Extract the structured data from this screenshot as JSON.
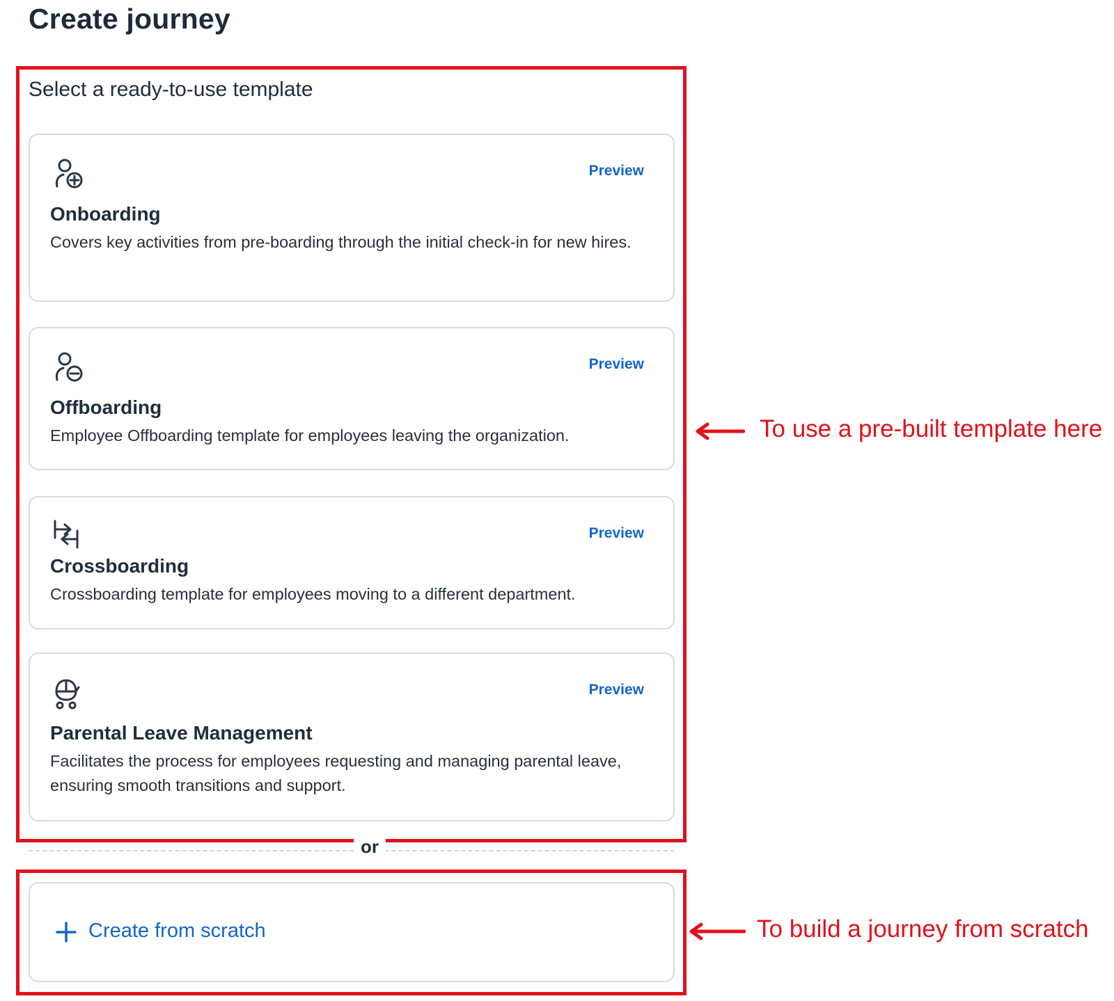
{
  "page": {
    "title": "Create journey"
  },
  "templates_section": {
    "heading": "Select a ready-to-use template",
    "cards": [
      {
        "icon": "person-add-icon",
        "title": "Onboarding",
        "description": "Covers key activities from pre-boarding through the initial check-in for new hires.",
        "preview_label": "Preview"
      },
      {
        "icon": "person-remove-icon",
        "title": "Offboarding",
        "description": "Employee Offboarding template for employees leaving the organization.",
        "preview_label": "Preview"
      },
      {
        "icon": "transfer-arrows-icon",
        "title": "Crossboarding",
        "description": "Crossboarding template for employees moving to a different department.",
        "preview_label": "Preview"
      },
      {
        "icon": "baby-stroller-icon",
        "title": "Parental Leave Management",
        "description": "Facilitates the process for employees requesting and managing parental leave, ensuring smooth transitions and support.",
        "preview_label": "Preview"
      }
    ]
  },
  "separator": {
    "label": "or"
  },
  "scratch": {
    "icon": "plus-icon",
    "label": "Create from scratch"
  },
  "annotations": [
    {
      "text": "To use a pre-built template here"
    },
    {
      "text": "To build a journey from scratch"
    }
  ],
  "colors": {
    "annotation_red": "#e0121b",
    "link_blue": "#1565c9",
    "card_border": "#d4dbe3",
    "text_dark": "#1f2d3d"
  }
}
